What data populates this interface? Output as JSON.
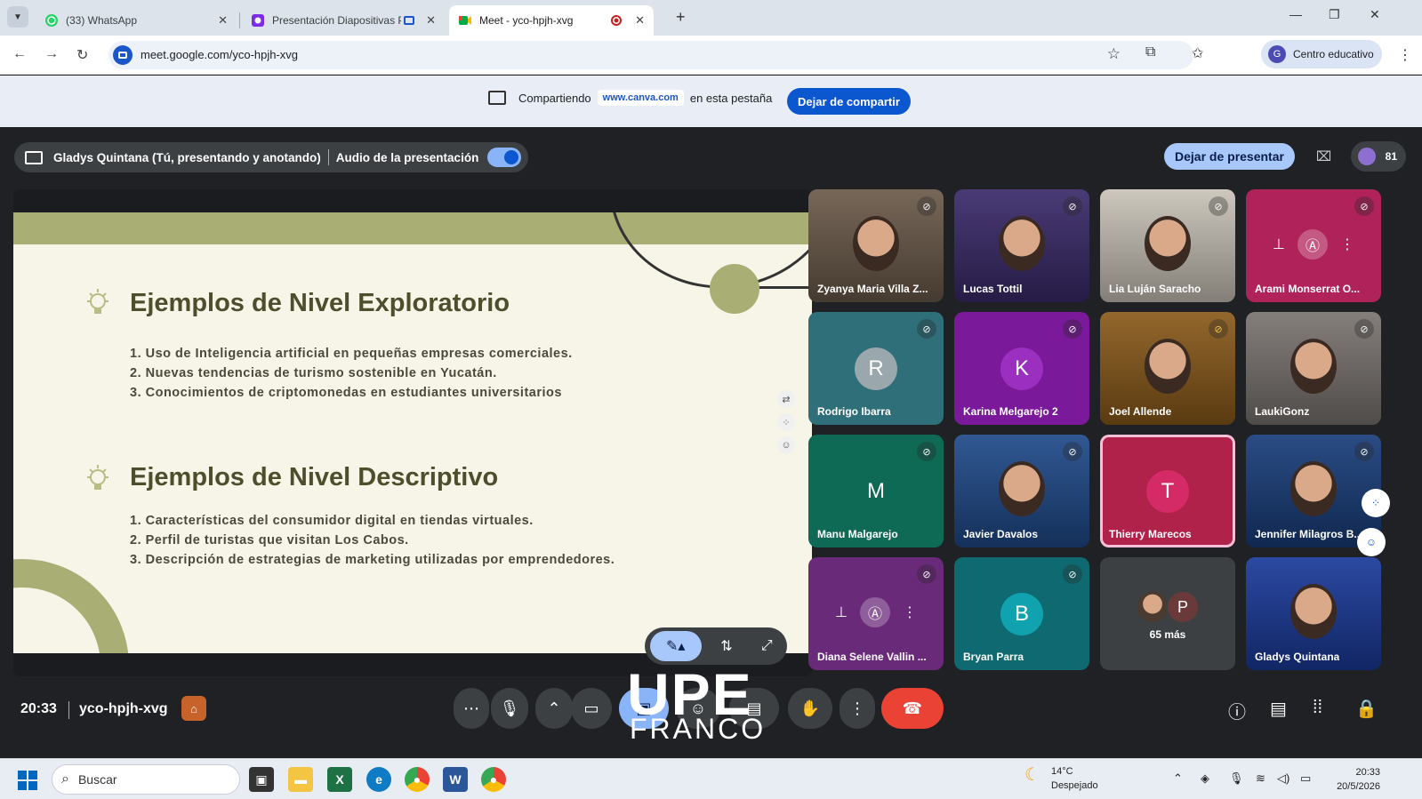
{
  "browser": {
    "tabs": [
      {
        "label": "(33) WhatsApp",
        "icon": "whatsapp-icon"
      },
      {
        "label": "Presentación Diapositivas P",
        "icon": "canva-icon"
      },
      {
        "label": "Meet - yco-hpjh-xvg",
        "icon": "meet-icon"
      }
    ],
    "url": "meet.google.com/yco-hpjh-xvg",
    "profile_initial": "G",
    "profile_label": "Centro educativo"
  },
  "share_bar": {
    "prefix": "Compartiendo",
    "domain": "www.canva.com",
    "suffix": "en esta pestaña",
    "stop_label": "Dejar de compartir"
  },
  "meet": {
    "presenter_label": "Gladys Quintana (Tú, presentando y anotando)",
    "audio_label": "Audio de la presentación",
    "stop_present_label": "Dejar de presentar",
    "participants_count": "81",
    "clock": "20:33",
    "meeting_code": "yco-hpjh-xvg",
    "more_label": "65 más",
    "more_initial": "P"
  },
  "slide": {
    "heading1": "Ejemplos de Nivel Exploratorio",
    "list1": [
      "1. Uso de Inteligencia artificial en pequeñas empresas comerciales.",
      "2. Nuevas tendencias de turismo sostenible en Yucatán.",
      "3. Conocimientos de criptomonedas en estudiantes universitarios"
    ],
    "heading2": "Ejemplos de Nivel Descriptivo",
    "list2": [
      "1. Características del consumidor digital en tiendas virtuales.",
      "2. Perfil de turistas que visitan Los Cabos.",
      "3. Descripción de estrategias de marketing utilizadas por emprendedores."
    ]
  },
  "participants": [
    {
      "name": "Zyanya Maria Villa Z...",
      "kind": "video",
      "bg": "#6b5a4a"
    },
    {
      "name": "Lucas Tottil",
      "kind": "video",
      "bg": "#3a2a6a"
    },
    {
      "name": "Lia Luján Saracho",
      "kind": "video",
      "bg": "#c9c3b8"
    },
    {
      "name": "Arami Monserrat O...",
      "kind": "pinned",
      "bg": "#b0225a"
    },
    {
      "name": "Rodrigo Ibarra",
      "kind": "initial",
      "initial": "R",
      "bg": "#2f6f7a",
      "avatar": "#9aa7ad"
    },
    {
      "name": "Karina Melgarejo 2",
      "kind": "initial",
      "initial": "K",
      "bg": "#7a1a9a",
      "avatar": "#9a2fc0"
    },
    {
      "name": "Joel Allende",
      "kind": "video",
      "bg": "#8a5a1a"
    },
    {
      "name": "LaukiGonz",
      "kind": "video",
      "bg": "#7a7470"
    },
    {
      "name": "Manu Malgarejo",
      "kind": "initial",
      "initial": "M",
      "bg": "#0e6a55",
      "avatar": "#0e6a55"
    },
    {
      "name": "Javier Davalos",
      "kind": "video",
      "bg": "#1f4a8a"
    },
    {
      "name": "Thierry Marecos",
      "kind": "initial",
      "initial": "T",
      "bg": "#b0224a",
      "avatar": "#d42b66"
    },
    {
      "name": "Jennifer Milagros B...",
      "kind": "video",
      "bg": "#183d7a"
    },
    {
      "name": "Diana Selene Vallin ...",
      "kind": "pinned",
      "bg": "#6a2a7a"
    },
    {
      "name": "Bryan Parra",
      "kind": "initial",
      "initial": "B",
      "bg": "#0e6a70",
      "avatar": "#11a2b0"
    },
    {
      "name": "",
      "kind": "more",
      "bg": "#3c4043"
    },
    {
      "name": "Gladys Quintana",
      "kind": "video",
      "bg": "#1a3a9a"
    }
  ],
  "watermark": {
    "line1": "UPE",
    "line2": "FRANCO"
  },
  "taskbar": {
    "search_placeholder": "Buscar",
    "temperature": "14°C",
    "weather": "Despejado",
    "time": "20:33",
    "date": "20/5/2026"
  },
  "colors": {
    "meet_bg": "#202124",
    "accent_blue": "#0b57d0",
    "end_call": "#ea4335",
    "slide_green": "#a9ae75"
  }
}
